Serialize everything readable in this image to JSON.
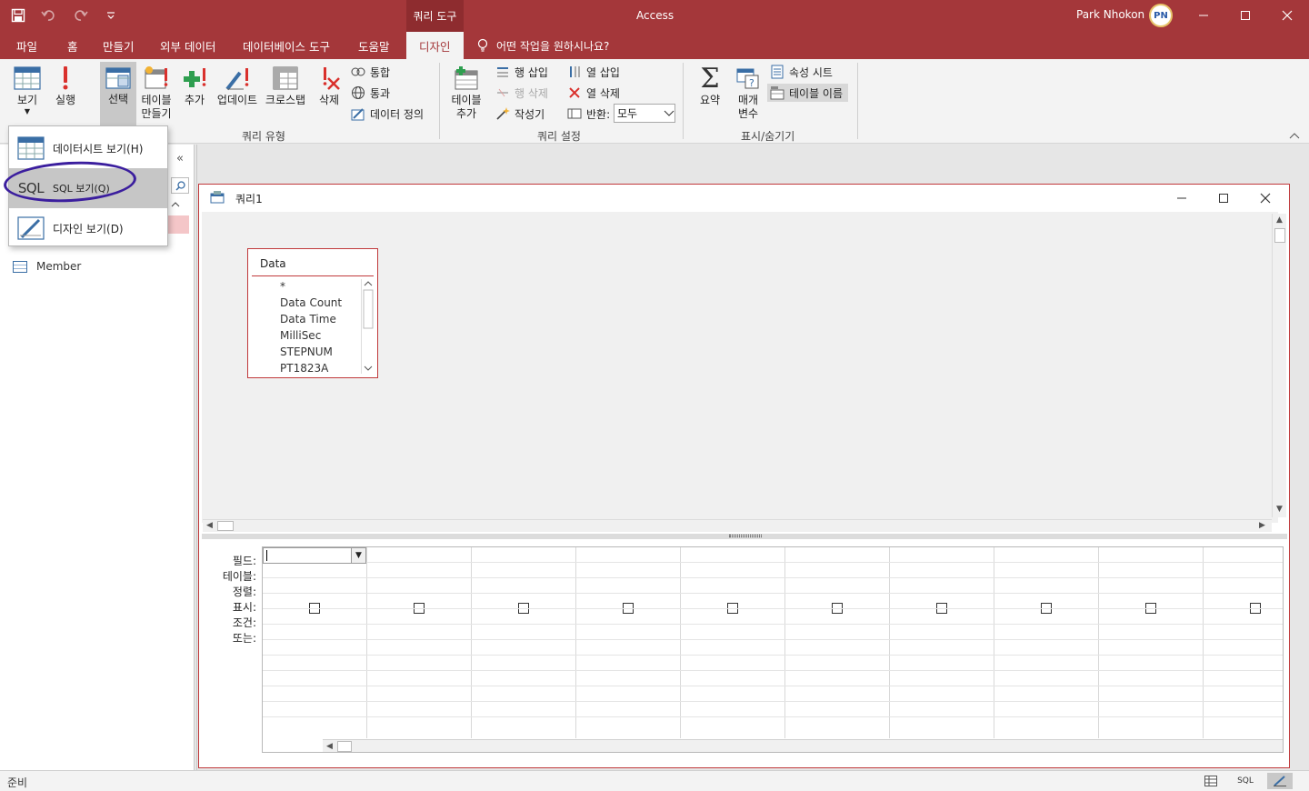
{
  "titlebar": {
    "context_tab": "쿼리 도구",
    "app_title": "Access",
    "user_name": "Park Nhokon",
    "avatar_text": "PN"
  },
  "menu": {
    "tabs": [
      "파일",
      "홈",
      "만들기",
      "외부 데이터",
      "데이터베이스 도구",
      "도움말",
      "디자인"
    ],
    "active_tab": "디자인",
    "tell_me": "어떤 작업을 원하시나요?"
  },
  "ribbon": {
    "view": "보기",
    "run": "실행",
    "select": "선택",
    "make_table_line1": "테이블",
    "make_table_line2": "만들기",
    "append": "추가",
    "update": "업데이트",
    "crosstab": "크로스탭",
    "delete": "삭제",
    "union": "통합",
    "pass_through": "통과",
    "data_definition": "데이터 정의",
    "group_query_type": "쿼리 유형",
    "show_table_line1": "테이블",
    "show_table_line2": "추가",
    "insert_rows": "행 삽입",
    "delete_rows": "행 삭제",
    "builder": "작성기",
    "insert_columns": "열 삽입",
    "delete_columns": "열 삭제",
    "return_label": "반환:",
    "return_value": "모두",
    "group_query_setup": "쿼리 설정",
    "totals": "요약",
    "parameters_line1": "매개",
    "parameters_line2": "변수",
    "property_sheet": "속성 시트",
    "table_names": "테이블 이름",
    "group_show_hide": "표시/숨기기"
  },
  "view_menu": {
    "datasheet": "데이터시트 보기(H)",
    "sql_icon": "SQL",
    "sql": "SQL 보기(Q)",
    "design": "디자인 보기(D)"
  },
  "nav": {
    "items": [
      "Member"
    ]
  },
  "query_window": {
    "title": "쿼리1",
    "table": {
      "name": "Data",
      "fields": [
        "*",
        "Data Count",
        "Data Time",
        "MilliSec",
        "STEPNUM",
        "PT1823A"
      ]
    },
    "grid_labels": [
      "필드:",
      "테이블:",
      "정렬:",
      "표시:",
      "조건:",
      "또는:"
    ],
    "column_count": 10
  },
  "status": {
    "text": "준비",
    "sql_btn": "SQL"
  },
  "colors": {
    "brand": "#a4373a",
    "annotation": "#3b1e9e"
  }
}
